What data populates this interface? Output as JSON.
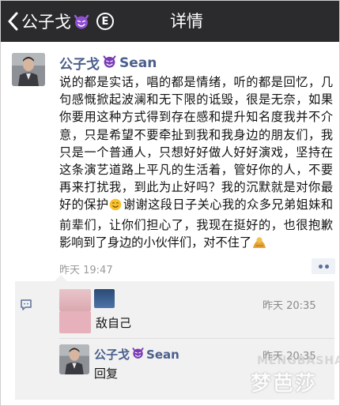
{
  "navbar": {
    "back_label": "公子戈",
    "back_emoji": "devil-emoji",
    "badge": "E",
    "title": "详情"
  },
  "post": {
    "author_name": "公子戈",
    "author_suffix": "Sean",
    "author_emoji": "devil-emoji",
    "body_part1": "说的都是实话，唱的都是情绪，听的都是回忆，几句感慨掀起波澜和无下限的诋毁，很是无奈，如果你要用这种方式得到存在感和提升知名度我并不介意，只是希望不要牵扯到我和我身边的朋友们，我只是一个普通人，只想好好做人好好演戏，坚持在这条演艺道路上平凡的生活着，管好你的人，不要再来打扰我，到此为止好吗？我的沉默就是对你最好的保护",
    "emoji1": "smile-emoji",
    "body_part2": "谢谢这段日子关心我的众多兄弟姐妹和前辈们，让你们担心了，我现在挺好的，也很抱歉影响到了身边的小伙伴们，对不住了",
    "emoji2": "bow-emoji",
    "time": "昨天 19:47",
    "more_icon": "more-dots-icon"
  },
  "comments": {
    "icon": "comment-icon",
    "first": {
      "text": "敌自己",
      "time": "昨天 20:35"
    },
    "reply": {
      "author_name": "公子戈",
      "author_suffix": "Sean",
      "author_emoji": "devil-emoji",
      "text": "回复",
      "time": "昨天 20:35"
    }
  },
  "watermark": {
    "latin": "MENGBASHA",
    "chinese": "梦芭莎"
  },
  "colors": {
    "navbar": "#2b2b2e",
    "name_link": "#4a5f8c",
    "devil": "#7a3bb5",
    "comment_bg": "#f1f1f1"
  }
}
